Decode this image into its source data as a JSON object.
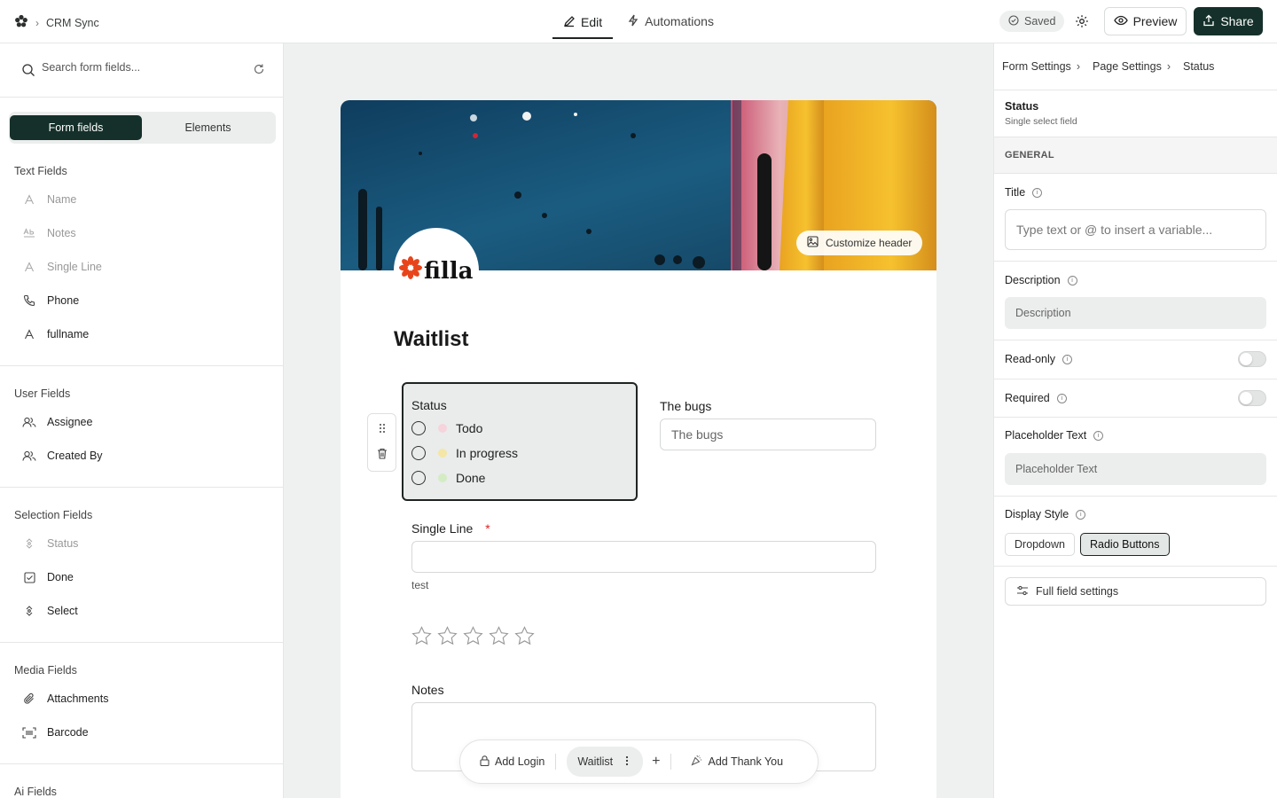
{
  "topbar": {
    "app_name": "CRM Sync",
    "tabs": [
      {
        "label": "Edit",
        "icon": "pencil-icon",
        "active": true
      },
      {
        "label": "Automations",
        "icon": "lightning-icon",
        "active": false
      }
    ],
    "saved_label": "Saved",
    "preview_label": "Preview",
    "share_label": "Share",
    "accent_color": "#15302a"
  },
  "left": {
    "search_placeholder": "Search form fields...",
    "segments": [
      "Form fields",
      "Elements"
    ],
    "groups": [
      {
        "title": "Text Fields",
        "items": [
          {
            "label": "Name",
            "icon": "text-a-icon",
            "dim": true
          },
          {
            "label": "Notes",
            "icon": "text-ab-icon",
            "dim": true
          },
          {
            "label": "Single Line",
            "icon": "text-a-icon",
            "dim": true
          },
          {
            "label": "Phone",
            "icon": "phone-icon",
            "dim": false
          },
          {
            "label": "fullname",
            "icon": "text-a-icon",
            "dim": false
          }
        ]
      },
      {
        "title": "User Fields",
        "items": [
          {
            "label": "Assignee",
            "icon": "users-icon",
            "dim": false
          },
          {
            "label": "Created By",
            "icon": "users-icon",
            "dim": false
          }
        ]
      },
      {
        "title": "Selection Fields",
        "items": [
          {
            "label": "Status",
            "icon": "select-icon",
            "dim": true
          },
          {
            "label": "Done",
            "icon": "checkbox-icon",
            "dim": false
          },
          {
            "label": "Select",
            "icon": "select-icon",
            "dim": false
          }
        ]
      },
      {
        "title": "Media Fields",
        "items": [
          {
            "label": "Attachments",
            "icon": "paperclip-icon",
            "dim": false
          },
          {
            "label": "Barcode",
            "icon": "barcode-icon",
            "dim": false
          }
        ]
      },
      {
        "title": "Ai Fields",
        "items": []
      }
    ]
  },
  "form": {
    "customize_header_label": "Customize header",
    "logo_text": "filla",
    "title": "Waitlist",
    "status_field": {
      "label": "Status",
      "options": [
        {
          "label": "Todo",
          "color": "#f7d3dc"
        },
        {
          "label": "In progress",
          "color": "#f4e6a6"
        },
        {
          "label": "Done",
          "color": "#d3ecc4"
        }
      ]
    },
    "bugs_field": {
      "label": "The bugs",
      "placeholder": "The bugs"
    },
    "single_line": {
      "label": "Single Line",
      "required_mark": "*",
      "help": "test"
    },
    "rating": {
      "max": 5,
      "value": 0
    },
    "notes": {
      "label": "Notes"
    }
  },
  "pagebar": {
    "add_login": "Add Login",
    "current_page": "Waitlist",
    "add_page": "+",
    "add_thank_you": "Add Thank You"
  },
  "right": {
    "crumbs": [
      "Form Settings",
      "Page Settings",
      "Status"
    ],
    "field_title": "Status",
    "field_subtitle": "Single select field",
    "section": "GENERAL",
    "title_label": "Title",
    "title_placeholder": "Type text or @ to insert a variable...",
    "description_label": "Description",
    "description_placeholder": "Description",
    "readonly_label": "Read-only",
    "readonly_value": false,
    "required_label": "Required",
    "required_value": false,
    "placeholder_label": "Placeholder Text",
    "placeholder_placeholder": "Placeholder Text",
    "display_style_label": "Display Style",
    "display_options": [
      "Dropdown",
      "Radio Buttons"
    ],
    "display_selected": "Radio Buttons",
    "full_settings_label": "Full field settings"
  }
}
